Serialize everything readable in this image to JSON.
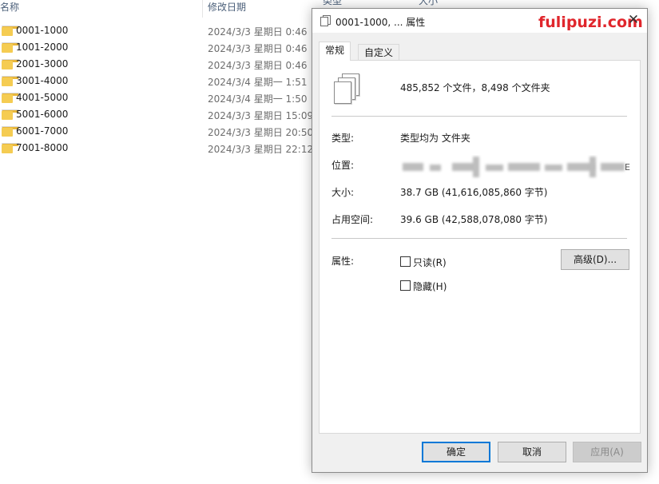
{
  "explorer": {
    "columns": {
      "name": "名称",
      "modified": "修改日期",
      "type": "类型",
      "size": "大小"
    },
    "rows": [
      {
        "name": "0001-1000",
        "modified": "2024/3/3 星期日 0:46"
      },
      {
        "name": "1001-2000",
        "modified": "2024/3/3 星期日 0:46"
      },
      {
        "name": "2001-3000",
        "modified": "2024/3/3 星期日 0:46"
      },
      {
        "name": "3001-4000",
        "modified": "2024/3/4 星期一 1:51"
      },
      {
        "name": "4001-5000",
        "modified": "2024/3/4 星期一 1:50"
      },
      {
        "name": "5001-6000",
        "modified": "2024/3/3 星期日 15:09"
      },
      {
        "name": "6001-7000",
        "modified": "2024/3/3 星期日 20:50"
      },
      {
        "name": "7001-8000",
        "modified": "2024/3/3 星期日 22:12"
      }
    ]
  },
  "dialog": {
    "title": "0001-1000, ... 属性",
    "close_symbol": "✕",
    "watermark": "fulipuzi.com",
    "tabs": [
      {
        "label": "常规",
        "active": true
      },
      {
        "label": "自定义",
        "active": false
      }
    ],
    "summary": "485,852 个文件，8,498 个文件夹",
    "type": {
      "label": "类型:",
      "value": "类型均为 文件夹"
    },
    "location": {
      "label": "位置:",
      "tail": "E"
    },
    "size": {
      "label": "大小:",
      "value": "38.7 GB (41,616,085,860 字节)"
    },
    "size_on_disk": {
      "label": "占用空间:",
      "value": "39.6 GB (42,588,078,080 字节)"
    },
    "attributes": {
      "label": "属性:",
      "readonly": {
        "label": "只读(R)",
        "checked": false
      },
      "hidden": {
        "label": "隐藏(H)",
        "checked": false
      },
      "advanced_button": "高级(D)..."
    },
    "buttons": {
      "ok": "确定",
      "cancel": "取消",
      "apply": "应用(A)"
    }
  },
  "colors": {
    "accent": "#0078d7",
    "watermark": "#e0262c",
    "folder": "#f5cc52"
  }
}
